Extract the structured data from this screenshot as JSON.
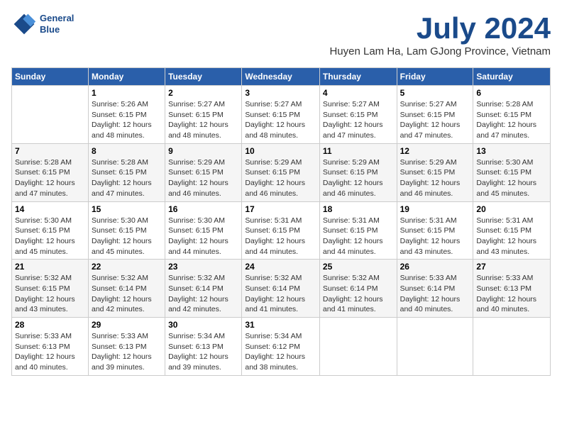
{
  "header": {
    "logo_line1": "General",
    "logo_line2": "Blue",
    "month": "July 2024",
    "location": "Huyen Lam Ha, Lam GJong Province, Vietnam"
  },
  "days_of_week": [
    "Sunday",
    "Monday",
    "Tuesday",
    "Wednesday",
    "Thursday",
    "Friday",
    "Saturday"
  ],
  "weeks": [
    [
      {
        "day": "",
        "info": ""
      },
      {
        "day": "1",
        "info": "Sunrise: 5:26 AM\nSunset: 6:15 PM\nDaylight: 12 hours and 48 minutes."
      },
      {
        "day": "2",
        "info": "Sunrise: 5:27 AM\nSunset: 6:15 PM\nDaylight: 12 hours and 48 minutes."
      },
      {
        "day": "3",
        "info": "Sunrise: 5:27 AM\nSunset: 6:15 PM\nDaylight: 12 hours and 48 minutes."
      },
      {
        "day": "4",
        "info": "Sunrise: 5:27 AM\nSunset: 6:15 PM\nDaylight: 12 hours and 47 minutes."
      },
      {
        "day": "5",
        "info": "Sunrise: 5:27 AM\nSunset: 6:15 PM\nDaylight: 12 hours and 47 minutes."
      },
      {
        "day": "6",
        "info": "Sunrise: 5:28 AM\nSunset: 6:15 PM\nDaylight: 12 hours and 47 minutes."
      }
    ],
    [
      {
        "day": "7",
        "info": "Sunrise: 5:28 AM\nSunset: 6:15 PM\nDaylight: 12 hours and 47 minutes."
      },
      {
        "day": "8",
        "info": "Sunrise: 5:28 AM\nSunset: 6:15 PM\nDaylight: 12 hours and 47 minutes."
      },
      {
        "day": "9",
        "info": "Sunrise: 5:29 AM\nSunset: 6:15 PM\nDaylight: 12 hours and 46 minutes."
      },
      {
        "day": "10",
        "info": "Sunrise: 5:29 AM\nSunset: 6:15 PM\nDaylight: 12 hours and 46 minutes."
      },
      {
        "day": "11",
        "info": "Sunrise: 5:29 AM\nSunset: 6:15 PM\nDaylight: 12 hours and 46 minutes."
      },
      {
        "day": "12",
        "info": "Sunrise: 5:29 AM\nSunset: 6:15 PM\nDaylight: 12 hours and 46 minutes."
      },
      {
        "day": "13",
        "info": "Sunrise: 5:30 AM\nSunset: 6:15 PM\nDaylight: 12 hours and 45 minutes."
      }
    ],
    [
      {
        "day": "14",
        "info": "Sunrise: 5:30 AM\nSunset: 6:15 PM\nDaylight: 12 hours and 45 minutes."
      },
      {
        "day": "15",
        "info": "Sunrise: 5:30 AM\nSunset: 6:15 PM\nDaylight: 12 hours and 45 minutes."
      },
      {
        "day": "16",
        "info": "Sunrise: 5:30 AM\nSunset: 6:15 PM\nDaylight: 12 hours and 44 minutes."
      },
      {
        "day": "17",
        "info": "Sunrise: 5:31 AM\nSunset: 6:15 PM\nDaylight: 12 hours and 44 minutes."
      },
      {
        "day": "18",
        "info": "Sunrise: 5:31 AM\nSunset: 6:15 PM\nDaylight: 12 hours and 44 minutes."
      },
      {
        "day": "19",
        "info": "Sunrise: 5:31 AM\nSunset: 6:15 PM\nDaylight: 12 hours and 43 minutes."
      },
      {
        "day": "20",
        "info": "Sunrise: 5:31 AM\nSunset: 6:15 PM\nDaylight: 12 hours and 43 minutes."
      }
    ],
    [
      {
        "day": "21",
        "info": "Sunrise: 5:32 AM\nSunset: 6:15 PM\nDaylight: 12 hours and 43 minutes."
      },
      {
        "day": "22",
        "info": "Sunrise: 5:32 AM\nSunset: 6:14 PM\nDaylight: 12 hours and 42 minutes."
      },
      {
        "day": "23",
        "info": "Sunrise: 5:32 AM\nSunset: 6:14 PM\nDaylight: 12 hours and 42 minutes."
      },
      {
        "day": "24",
        "info": "Sunrise: 5:32 AM\nSunset: 6:14 PM\nDaylight: 12 hours and 41 minutes."
      },
      {
        "day": "25",
        "info": "Sunrise: 5:32 AM\nSunset: 6:14 PM\nDaylight: 12 hours and 41 minutes."
      },
      {
        "day": "26",
        "info": "Sunrise: 5:33 AM\nSunset: 6:14 PM\nDaylight: 12 hours and 40 minutes."
      },
      {
        "day": "27",
        "info": "Sunrise: 5:33 AM\nSunset: 6:13 PM\nDaylight: 12 hours and 40 minutes."
      }
    ],
    [
      {
        "day": "28",
        "info": "Sunrise: 5:33 AM\nSunset: 6:13 PM\nDaylight: 12 hours and 40 minutes."
      },
      {
        "day": "29",
        "info": "Sunrise: 5:33 AM\nSunset: 6:13 PM\nDaylight: 12 hours and 39 minutes."
      },
      {
        "day": "30",
        "info": "Sunrise: 5:34 AM\nSunset: 6:13 PM\nDaylight: 12 hours and 39 minutes."
      },
      {
        "day": "31",
        "info": "Sunrise: 5:34 AM\nSunset: 6:12 PM\nDaylight: 12 hours and 38 minutes."
      },
      {
        "day": "",
        "info": ""
      },
      {
        "day": "",
        "info": ""
      },
      {
        "day": "",
        "info": ""
      }
    ]
  ]
}
